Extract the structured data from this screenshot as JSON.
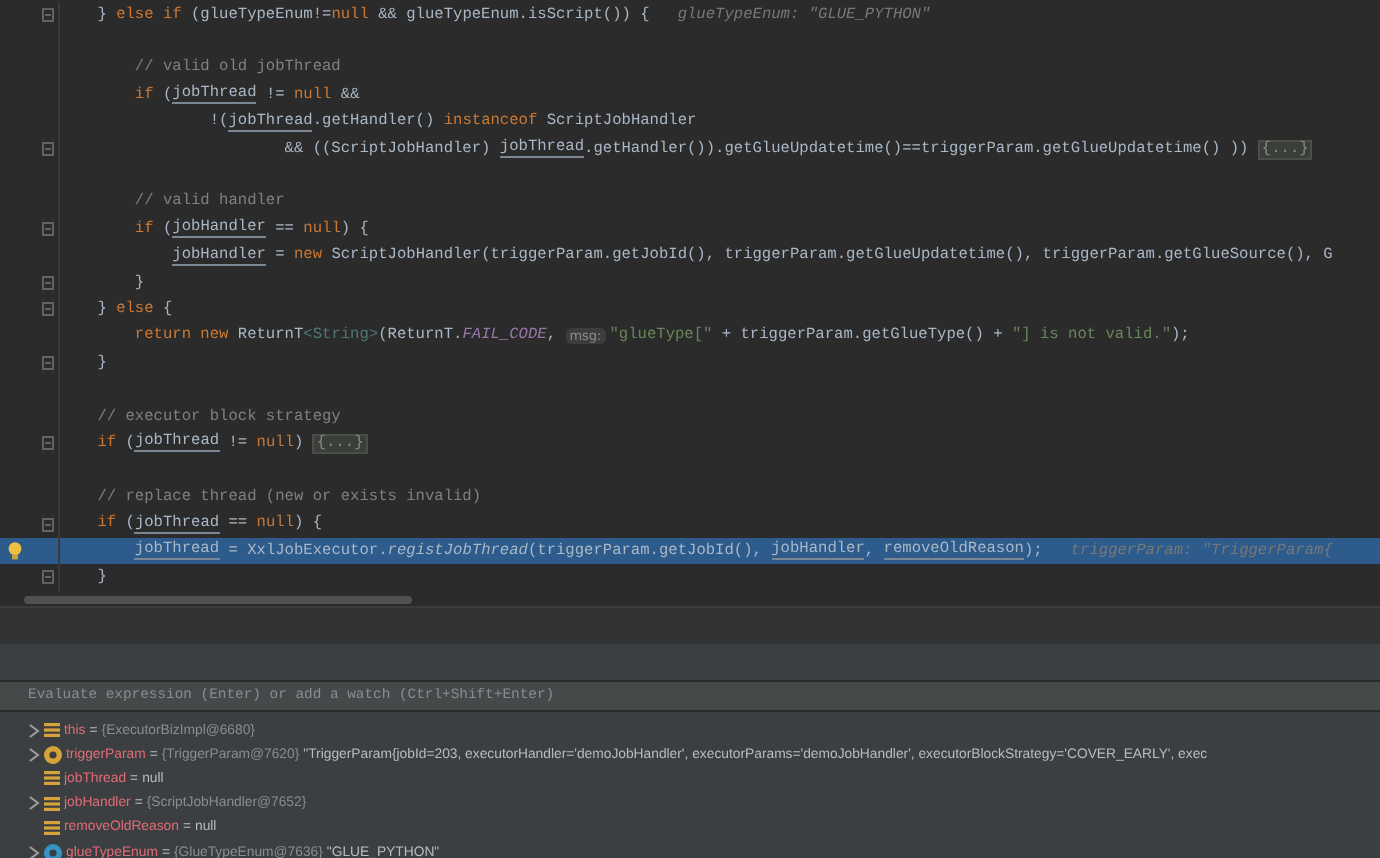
{
  "editor": {
    "lines": [
      {
        "kind": "code",
        "current": false,
        "fold": true,
        "segments": [
          {
            "kind": "plain",
            "t": "} "
          },
          {
            "kind": "kw",
            "t": "else if "
          },
          {
            "kind": "plain",
            "t": "(glueTypeEnum!="
          },
          {
            "kind": "kw",
            "t": "null "
          },
          {
            "kind": "plain",
            "t": "&& glueTypeEnum.isScript()) {"
          },
          {
            "kind": "hint",
            "t": "glueTypeEnum: \"GLUE_PYTHON\""
          }
        ],
        "children": [
          {
            "kind": "blank"
          },
          {
            "kind": "code",
            "current": false,
            "fold": false,
            "segments": [
              {
                "kind": "cm",
                "t": "// valid old jobThread"
              }
            ]
          },
          {
            "kind": "code",
            "current": false,
            "fold": false,
            "segments": [
              {
                "kind": "kw",
                "t": "if "
              },
              {
                "kind": "plain",
                "t": "("
              },
              {
                "kind": "var",
                "t": "jobThread"
              },
              {
                "kind": "plain",
                "t": " != "
              },
              {
                "kind": "kw",
                "t": "null "
              },
              {
                "kind": "plain",
                "t": "&&"
              }
            ],
            "continuation": [
              {
                "kind": "code",
                "current": false,
                "fold": false,
                "segments": [
                  {
                    "kind": "plain",
                    "t": "!("
                  },
                  {
                    "kind": "var",
                    "t": "jobThread"
                  },
                  {
                    "kind": "plain",
                    "t": ".getHandler() "
                  },
                  {
                    "kind": "kw",
                    "t": "instanceof "
                  },
                  {
                    "kind": "plain",
                    "t": "ScriptJobHandler"
                  }
                ],
                "continuation": [
                  {
                    "kind": "code",
                    "current": false,
                    "fold": true,
                    "segments": [
                      {
                        "kind": "plain",
                        "t": "&& ((ScriptJobHandler) "
                      },
                      {
                        "kind": "var",
                        "t": "jobThread"
                      },
                      {
                        "kind": "plain",
                        "t": ".getHandler()).getGlueUpdatetime()==triggerParam.getGlueUpdatetime() )) "
                      },
                      {
                        "kind": "fold",
                        "t": "{...}"
                      }
                    ]
                  }
                ]
              }
            ]
          },
          {
            "kind": "blank"
          },
          {
            "kind": "code",
            "current": false,
            "fold": false,
            "segments": [
              {
                "kind": "cm",
                "t": "// valid handler"
              }
            ]
          },
          {
            "kind": "code",
            "current": false,
            "fold": true,
            "segments": [
              {
                "kind": "kw",
                "t": "if "
              },
              {
                "kind": "plain",
                "t": "("
              },
              {
                "kind": "var",
                "t": "jobHandler"
              },
              {
                "kind": "plain",
                "t": " == "
              },
              {
                "kind": "kw",
                "t": "null"
              },
              {
                "kind": "plain",
                "t": ") {"
              }
            ],
            "children": [
              {
                "kind": "code",
                "current": false,
                "fold": false,
                "segments": [
                  {
                    "kind": "var",
                    "t": "jobHandler"
                  },
                  {
                    "kind": "plain",
                    "t": " = "
                  },
                  {
                    "kind": "kw",
                    "t": "new "
                  },
                  {
                    "kind": "plain",
                    "t": "ScriptJobHandler(triggerParam.getJobId(), triggerParam.getGlueUpdatetime(), triggerParam.getGlueSource(), G"
                  }
                ]
              }
            ]
          },
          {
            "kind": "code",
            "current": false,
            "fold": true,
            "segments": [
              {
                "kind": "plain",
                "t": "}"
              }
            ]
          }
        ]
      },
      {
        "kind": "code",
        "current": false,
        "fold": true,
        "segments": [
          {
            "kind": "plain",
            "t": "} "
          },
          {
            "kind": "kw",
            "t": "else "
          },
          {
            "kind": "plain",
            "t": "{"
          }
        ],
        "children": [
          {
            "kind": "code",
            "current": false,
            "fold": false,
            "segments": [
              {
                "kind": "kw",
                "t": "return new "
              },
              {
                "kind": "plain",
                "t": "ReturnT"
              },
              {
                "kind": "generic",
                "t": "<String>"
              },
              {
                "kind": "plain",
                "t": "(ReturnT."
              },
              {
                "kind": "field",
                "t": "FAIL_CODE"
              },
              {
                "kind": "plain",
                "t": ", "
              },
              {
                "kind": "param",
                "t": "msg:"
              },
              {
                "kind": "str",
                "t": "\"glueType[\""
              },
              {
                "kind": "plain",
                "t": " + triggerParam.getGlueType() + "
              },
              {
                "kind": "str",
                "t": "\"] is not valid.\""
              },
              {
                "kind": "plain",
                "t": ");"
              }
            ]
          }
        ]
      },
      {
        "kind": "code",
        "current": false,
        "fold": true,
        "segments": [
          {
            "kind": "plain",
            "t": "}"
          }
        ]
      },
      {
        "kind": "blank"
      },
      {
        "kind": "code",
        "current": false,
        "fold": false,
        "segments": [
          {
            "kind": "cm",
            "t": "// executor block strategy"
          }
        ]
      },
      {
        "kind": "code",
        "current": false,
        "fold": true,
        "segments": [
          {
            "kind": "kw",
            "t": "if "
          },
          {
            "kind": "plain",
            "t": "("
          },
          {
            "kind": "var",
            "t": "jobThread"
          },
          {
            "kind": "plain",
            "t": " != "
          },
          {
            "kind": "kw",
            "t": "null"
          },
          {
            "kind": "plain",
            "t": ") "
          },
          {
            "kind": "fold",
            "t": "{...}"
          }
        ]
      },
      {
        "kind": "blank"
      },
      {
        "kind": "code",
        "current": false,
        "fold": false,
        "segments": [
          {
            "kind": "cm",
            "t": "// replace thread (new or exists invalid)"
          }
        ]
      },
      {
        "kind": "code",
        "current": false,
        "fold": true,
        "segments": [
          {
            "kind": "kw",
            "t": "if "
          },
          {
            "kind": "plain",
            "t": "("
          },
          {
            "kind": "var",
            "t": "jobThread"
          },
          {
            "kind": "plain",
            "t": " == "
          },
          {
            "kind": "kw",
            "t": "null"
          },
          {
            "kind": "plain",
            "t": ") {"
          }
        ],
        "children": [
          {
            "kind": "code",
            "current": true,
            "fold": false,
            "segments": [
              {
                "kind": "var",
                "t": "jobThread"
              },
              {
                "kind": "plain",
                "t": " = XxlJobExecutor."
              },
              {
                "kind": "static",
                "t": "registJobThread"
              },
              {
                "kind": "plain",
                "t": "(triggerParam.getJobId(), "
              },
              {
                "kind": "var",
                "t": "jobHandler"
              },
              {
                "kind": "plain",
                "t": ", "
              },
              {
                "kind": "var",
                "t": "removeOldReason"
              },
              {
                "kind": "plain",
                "t": ");"
              },
              {
                "kind": "hint",
                "t": "triggerParam: \"TriggerParam{"
              }
            ]
          }
        ]
      },
      {
        "kind": "code",
        "current": false,
        "fold": true,
        "segments": [
          {
            "kind": "plain",
            "t": "}"
          }
        ]
      }
    ]
  },
  "watch": {
    "placeholder": "Evaluate expression (Enter) or add a watch (Ctrl+Shift+Enter)"
  },
  "variables": [
    {
      "kind": "field",
      "expandable": true,
      "name": "this",
      "sign": "=",
      "type": "{ExecutorBizImpl@6680}"
    },
    {
      "kind": "param",
      "expandable": true,
      "name": "triggerParam",
      "sign": "=",
      "type": "{TriggerParam@7620}",
      "value": "\"TriggerParam{jobId=203, executorHandler='demoJobHandler', executorParams='demoJobHandler', executorBlockStrategy='COVER_EARLY', exec"
    },
    {
      "kind": "field",
      "expandable": false,
      "name": "jobThread",
      "sign": "=",
      "value": "null"
    },
    {
      "kind": "field",
      "expandable": true,
      "name": "jobHandler",
      "sign": "=",
      "type": "{ScriptJobHandler@7652}"
    },
    {
      "kind": "field",
      "expandable": false,
      "name": "removeOldReason",
      "sign": "=",
      "value": "null"
    },
    {
      "kind": "enum",
      "expandable": true,
      "name": "glueTypeEnum",
      "sign": "=",
      "type": "{GlueTypeEnum@7636}",
      "value": "\"GLUE_PYTHON\""
    }
  ]
}
